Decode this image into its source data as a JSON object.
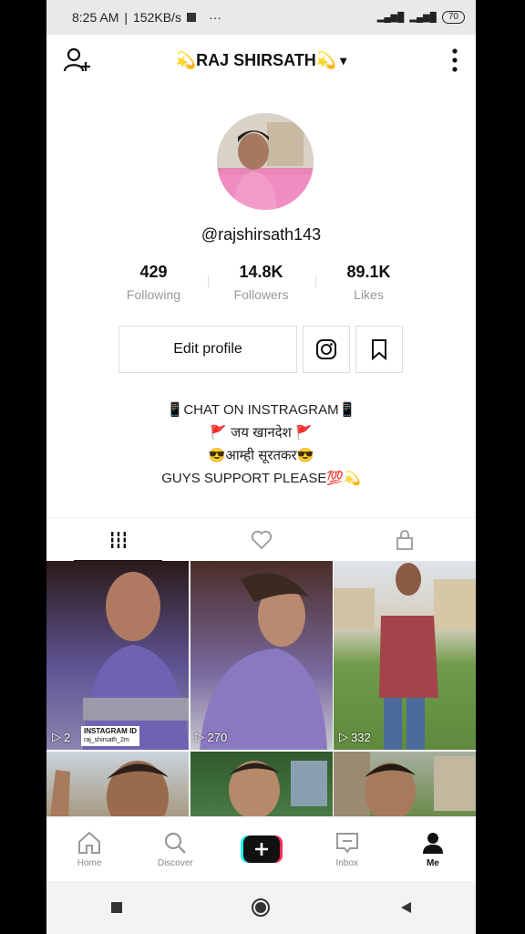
{
  "status": {
    "time": "8:25 AM",
    "speed": "152KB/s",
    "dots": "···",
    "battery": "70"
  },
  "header": {
    "title": "💫RAJ SHIRSATH💫",
    "dropdown": "▾"
  },
  "profile": {
    "handle": "@rajshirsath143"
  },
  "stats": [
    {
      "num": "429",
      "label": "Following"
    },
    {
      "num": "14.8K",
      "label": "Followers"
    },
    {
      "num": "89.1K",
      "label": "Likes"
    }
  ],
  "actions": {
    "edit": "Edit profile"
  },
  "bio": [
    "📱CHAT ON INSTRAGRAM📱",
    "🚩 जय खानदेश 🚩",
    "😎आम्ही सूरतकर😎",
    "GUYS SUPPORT PLEASE💯💫"
  ],
  "videos": [
    {
      "views": "2",
      "tag_title": "INSTAGRAM ID",
      "tag_sub": "raj_shirsath_2m",
      "bg": "#5c4a8e"
    },
    {
      "views": "270",
      "bg": "#7a6aa0"
    },
    {
      "views": "332",
      "bg": "#6f9b4a"
    },
    {
      "views": "",
      "bg": "#8a7a5c"
    },
    {
      "views": "",
      "bg": "#3e6b3a"
    },
    {
      "views": "",
      "bg": "#7d6f5d"
    }
  ],
  "nav": [
    {
      "label": "Home",
      "icon": "home-icon"
    },
    {
      "label": "Discover",
      "icon": "search-icon"
    },
    {
      "label": "",
      "icon": "plus-icon"
    },
    {
      "label": "Inbox",
      "icon": "inbox-icon"
    },
    {
      "label": "Me",
      "icon": "profile-icon"
    }
  ]
}
